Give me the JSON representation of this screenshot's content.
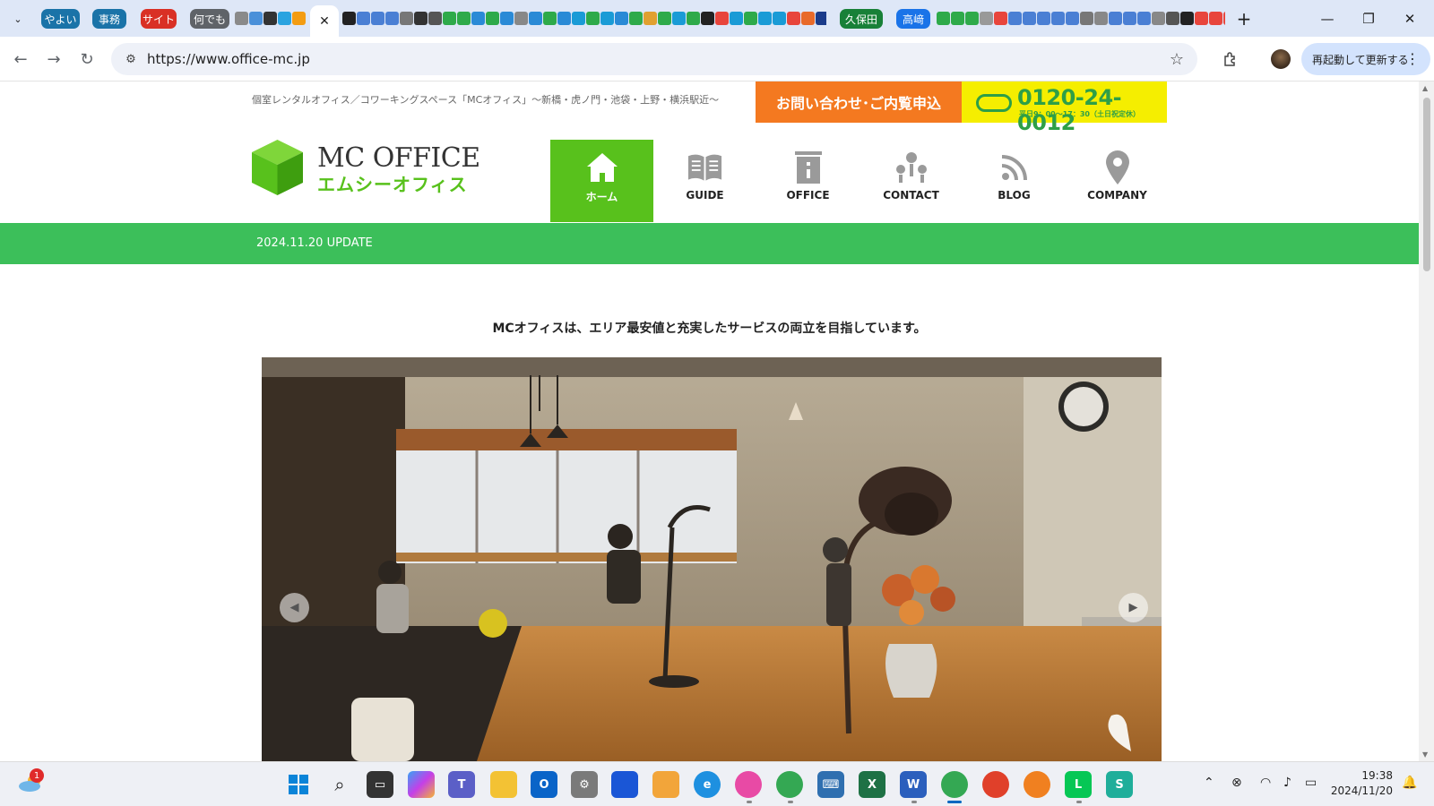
{
  "browser": {
    "tab_groups": [
      {
        "label": "やよい",
        "color": "#1a73a8"
      },
      {
        "label": "事務",
        "color": "#1a73a8"
      },
      {
        "label": "サイト",
        "color": "#d93025"
      },
      {
        "label": "何でも",
        "color": "#5f6368"
      },
      {
        "label": "久保田",
        "color": "#188038"
      },
      {
        "label": "高﨑",
        "color": "#1a73e8"
      }
    ],
    "active_tab_close": "✕",
    "new_tab": "+",
    "url": "https://www.office-mc.jp",
    "update_button": "再起動して更新する"
  },
  "site": {
    "tagline": "個室レンタルオフィス／コワーキングスペース「MCオフィス」～新橋・虎ノ門・池袋・上野・横浜駅近～",
    "cta_contact": "お問い合わせ･ご内覧申込",
    "cta_phone": "0120-24-0012",
    "cta_hours": "平日9：00～17：30（土日祝定休）",
    "logo_en": "MC OFFICE",
    "logo_ja": "エムシーオフィス",
    "nav": [
      {
        "label": "ホーム",
        "icon": "home-icon",
        "active": true
      },
      {
        "label": "GUIDE",
        "icon": "book-icon",
        "active": false
      },
      {
        "label": "OFFICE",
        "icon": "building-icon",
        "active": false
      },
      {
        "label": "CONTACT",
        "icon": "contact-people-icon",
        "active": false
      },
      {
        "label": "BLOG",
        "icon": "rss-icon",
        "active": false
      },
      {
        "label": "COMPANY",
        "icon": "map-pin-icon",
        "active": false
      }
    ],
    "update_notice": "2024.11.20 UPDATE",
    "lead": "MCオフィスは、エリア最安値と充実したサービスの両立を目指しています。",
    "slider_prev": "◀",
    "slider_next": "▶"
  },
  "taskbar": {
    "weather_badge": "1",
    "time": "19:38",
    "date": "2024/11/20"
  },
  "colors": {
    "brand_green": "#58c11c",
    "update_bar": "#3cbf5a",
    "cta_orange": "#f47920",
    "cta_yellow": "#f5ee00"
  }
}
